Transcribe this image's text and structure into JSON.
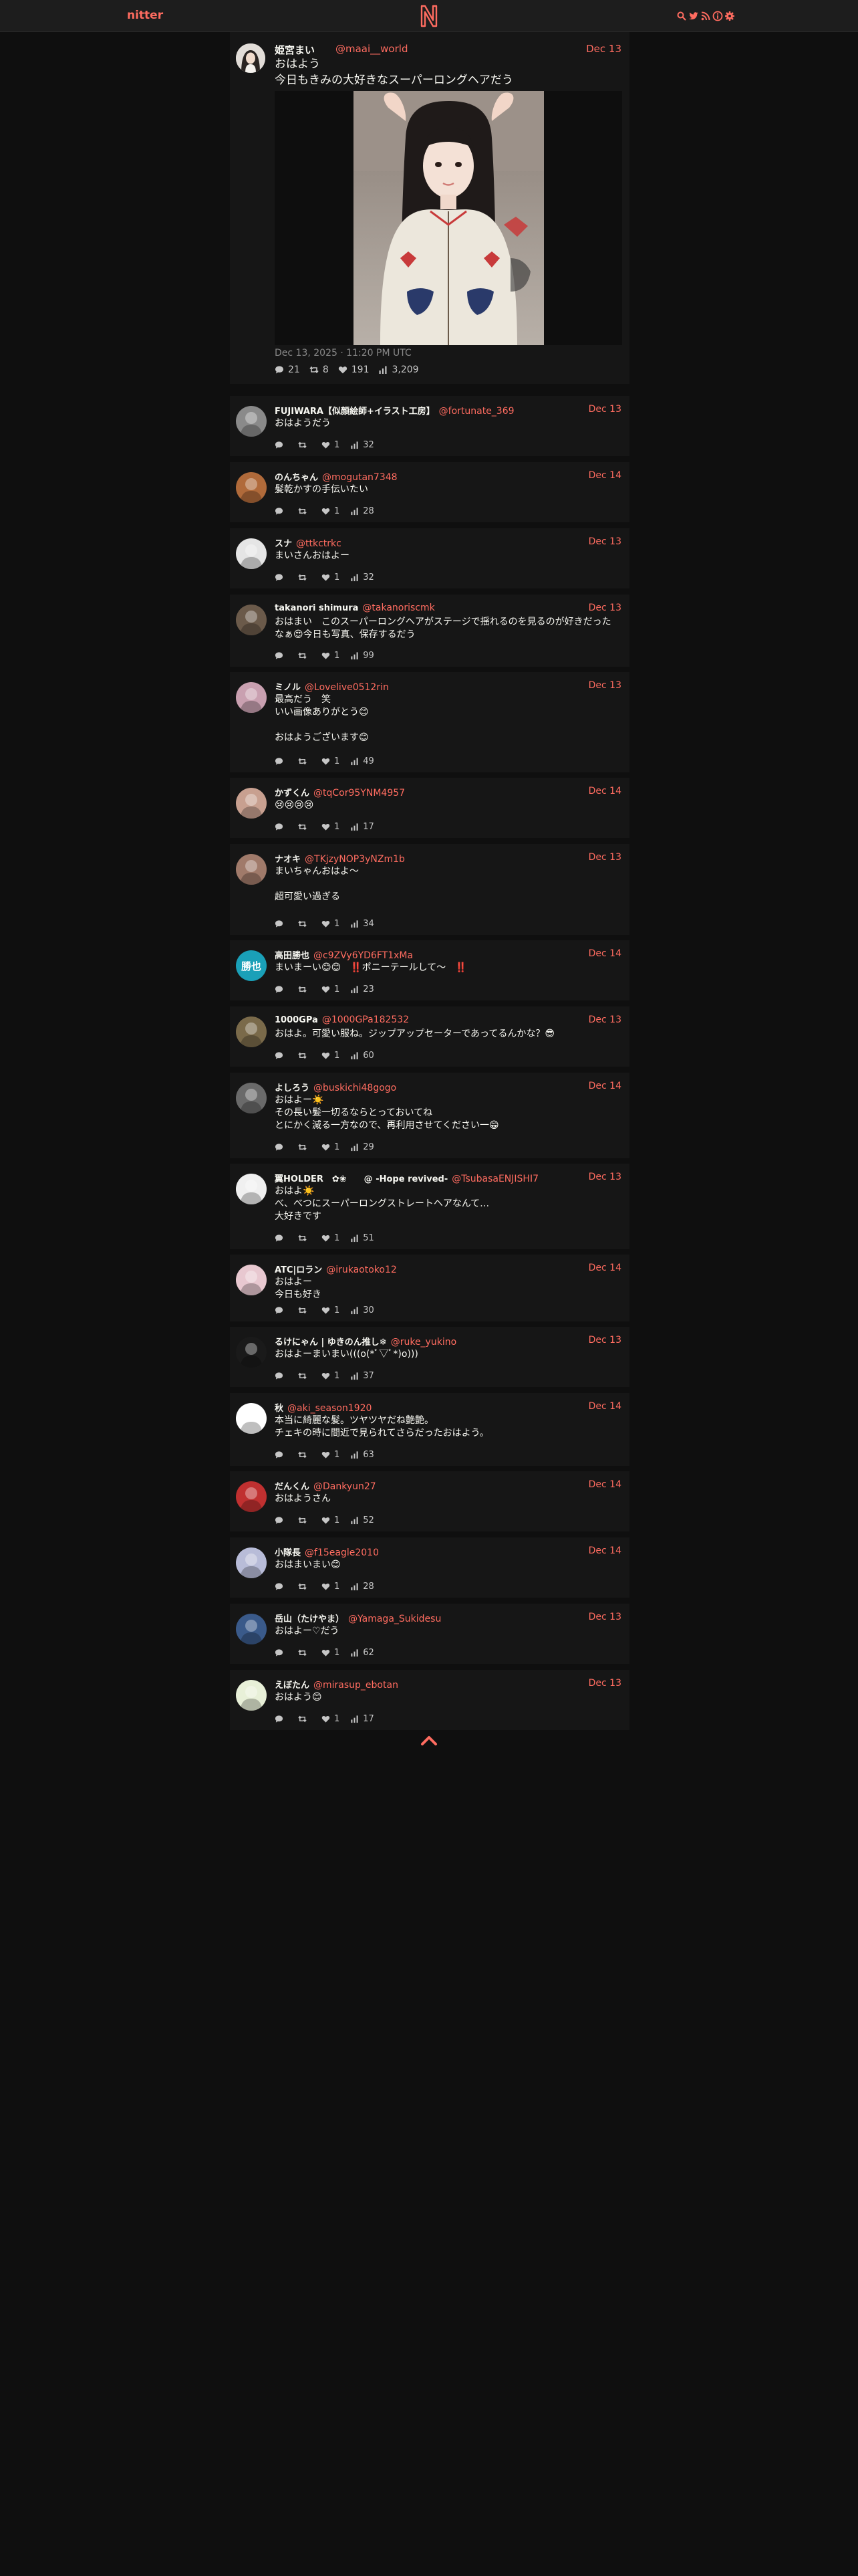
{
  "nav": {
    "brand": "nitter",
    "icons": [
      "search-icon",
      "twitter-icon",
      "rss-icon",
      "info-icon",
      "gear-icon"
    ]
  },
  "main_tweet": {
    "display_name": "姫宮まい",
    "handle": "@maai__world",
    "date": "Dec 13",
    "text": "おはよう\n今日もきみの大好きなスーパーロングヘアだう",
    "published": "Dec 13, 2025 · 11:20 PM UTC",
    "replies": "21",
    "retweets": "8",
    "likes": "191",
    "views": "3,209"
  },
  "replies": [
    {
      "name": "FUJIWARA【似顔絵師+イラスト工房】",
      "handle": "@fortunate_369",
      "date": "Dec 13",
      "text": "おはようだう",
      "replies": "",
      "retweets": "",
      "likes": "1",
      "views": "32",
      "avatar_color": "#8a8a8a"
    },
    {
      "name": "のんちゃん",
      "handle": "@mogutan7348",
      "date": "Dec 14",
      "text": "髪乾かすの手伝いたい",
      "replies": "",
      "retweets": "",
      "likes": "1",
      "views": "28",
      "avatar_color": "#b06a3a"
    },
    {
      "name": "スナ",
      "handle": "@ttkctrkc",
      "date": "Dec 13",
      "text": "まいさんおはよー",
      "replies": "",
      "retweets": "",
      "likes": "1",
      "views": "32",
      "avatar_color": "#e5e5e5"
    },
    {
      "name": "takanori shimura",
      "handle": "@takanoriscmk",
      "date": "Dec 13",
      "text": "おはまい　このスーパーロングヘアがステージで揺れるのを見るのが好きだったなぁ😍今日も写真、保存するだう",
      "replies": "",
      "retweets": "",
      "likes": "1",
      "views": "99",
      "avatar_color": "#6b5a4a"
    },
    {
      "name": "ミノル",
      "handle": "@Lovelive0512rin",
      "date": "Dec 13",
      "text": "最高だう　笑\nいい画像ありがとう😊\n\nおはようございます😊",
      "replies": "",
      "retweets": "",
      "likes": "1",
      "views": "49",
      "avatar_color": "#c9a0b0"
    },
    {
      "name": "かずくん",
      "handle": "@tqCor95YNM4957",
      "date": "Dec 14",
      "text": "😢😢😢😢",
      "replies": "",
      "retweets": "",
      "likes": "1",
      "views": "17",
      "avatar_color": "#c8a090"
    },
    {
      "name": "ナオキ",
      "handle": "@TKjzyNOP3yNZm1b",
      "date": "Dec 13",
      "text": "まいちゃんおはよ〜\n\n超可愛い過ぎる",
      "replies": "",
      "retweets": "",
      "likes": "1",
      "views": "34",
      "avatar_color": "#a07a6a"
    },
    {
      "name": "高田勝也",
      "handle": "@c9ZVy6YD6FT1xMa",
      "date": "Dec 14",
      "text": "まいまーい😊😊　‼️ポニーテールして〜　‼️",
      "replies": "",
      "retweets": "",
      "likes": "1",
      "views": "23",
      "avatar_color": "#1aa0b8",
      "avatar_text": "勝也"
    },
    {
      "name": "1000GPa",
      "handle": "@1000GPa182532",
      "date": "Dec 13",
      "text": "おはよ。可愛い服ね。ジップアップセーターであってるんかな？😎",
      "replies": "",
      "retweets": "",
      "likes": "1",
      "views": "60",
      "avatar_color": "#7a6a4a"
    },
    {
      "name": "よしろう",
      "handle": "@buskichi48gogo",
      "date": "Dec 14",
      "text": "おはよー☀️\nその長い髪一切るならとっておいてね\nとにかく減る一方なので、再利用させてください一😁",
      "replies": "",
      "retweets": "",
      "likes": "1",
      "views": "29",
      "avatar_color": "#6a6a6a"
    },
    {
      "name": "翼HOLDER　✿❀　　@ -Hope revived-",
      "handle": "@TsubasaENJISHI7",
      "date": "Dec 13",
      "text": "おはよ☀️\nべ、べつにスーパーロングストレートヘアなんて…\n大好きです",
      "replies": "",
      "retweets": "",
      "likes": "1",
      "views": "51",
      "avatar_color": "#f0f0f0"
    },
    {
      "name": "ATC|ロラン",
      "handle": "@irukaotoko12",
      "date": "Dec 14",
      "text": "おはよー\n今日も好き",
      "replies": "",
      "retweets": "",
      "likes": "1",
      "views": "30",
      "avatar_color": "#e8c8d0"
    },
    {
      "name": "るけにゃん | ゆきのん推し❄",
      "handle": "@ruke_yukino",
      "date": "Dec 13",
      "text": "おはよーまいまい(((o(*ﾟ▽ﾟ*)o)))",
      "replies": "",
      "retweets": "",
      "likes": "1",
      "views": "37",
      "avatar_color": "#1a1a1a"
    },
    {
      "name": "秋",
      "handle": "@aki_season1920",
      "date": "Dec 14",
      "text": "本当に綺麗な髪。ツヤツヤだね艶艶。\nチェキの時に間近で見られてさらだったおはよう。",
      "replies": "",
      "retweets": "",
      "likes": "1",
      "views": "63",
      "avatar_color": "#ffffff"
    },
    {
      "name": "だんくん",
      "handle": "@Dankyun27",
      "date": "Dec 14",
      "text": "おはようさん",
      "replies": "",
      "retweets": "",
      "likes": "1",
      "views": "52",
      "avatar_color": "#c03030"
    },
    {
      "name": "小隊長",
      "handle": "@f15eagle2010",
      "date": "Dec 14",
      "text": "おはまいまい😊",
      "replies": "",
      "retweets": "",
      "likes": "1",
      "views": "28",
      "avatar_color": "#b8bcd8"
    },
    {
      "name": "岳山（たけやま）",
      "handle": "@Yamaga_Sukidesu",
      "date": "Dec 13",
      "text": "おはよー♡だう",
      "replies": "",
      "retweets": "",
      "likes": "1",
      "views": "62",
      "avatar_color": "#3a5a8a"
    },
    {
      "name": "えぼたん",
      "handle": "@mirasup_ebotan",
      "date": "Dec 13",
      "text": "おはよう😊",
      "replies": "",
      "retweets": "",
      "likes": "1",
      "views": "17",
      "avatar_color": "#e8f0d8"
    }
  ],
  "colors": {
    "accent": "#ff6c60",
    "bg": "#0f0f0f",
    "card": "#161616",
    "nav": "#1d1d1d"
  }
}
